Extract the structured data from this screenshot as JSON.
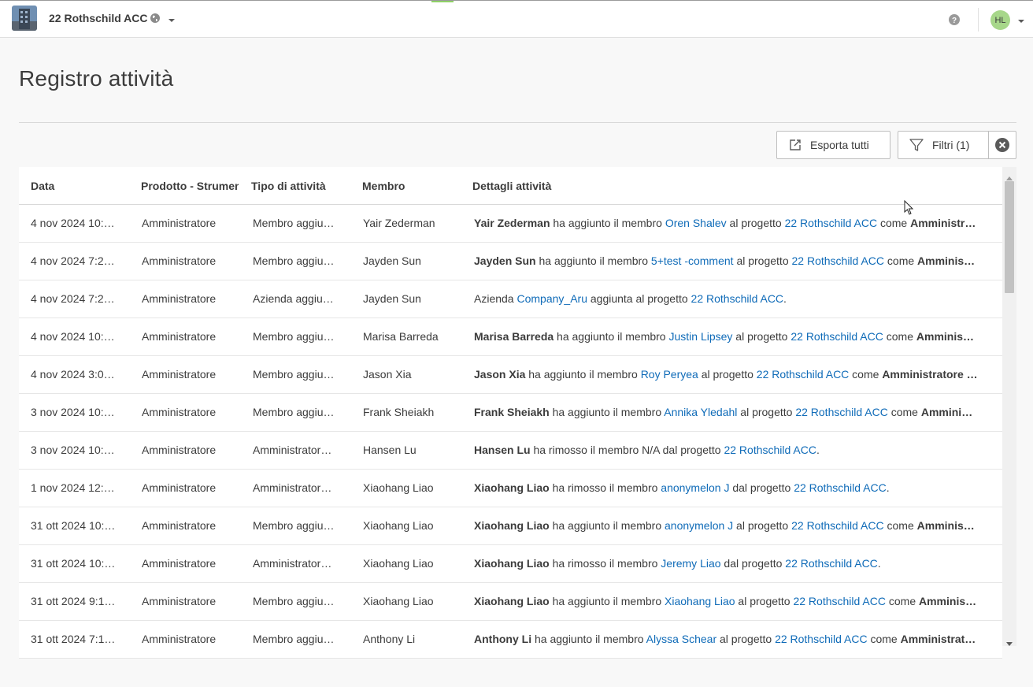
{
  "header": {
    "project_name": "22 Rothschild ACC",
    "avatar_initials": "HL",
    "icons": [
      "project-thumbnail",
      "globe-icon",
      "chevron-down-icon",
      "help-icon",
      "chevron-down-icon"
    ]
  },
  "page": {
    "title": "Registro attività"
  },
  "toolbar": {
    "export_label": "Esporta tutti",
    "filter_label": "Filtri (1)"
  },
  "table": {
    "columns": [
      "Data",
      "Prodotto - Strumento",
      "Tipo di attività",
      "Membro",
      "Dettagli attività"
    ],
    "rows": [
      {
        "date": "4 nov 2024 10:…",
        "product": "Amministratore",
        "type": "Membro aggiu…",
        "member": "Yair Zederman",
        "detail": [
          {
            "t": "b",
            "v": "Yair Zederman"
          },
          {
            "t": "s",
            "v": " ha aggiunto il membro "
          },
          {
            "t": "l",
            "v": "Oren Shalev"
          },
          {
            "t": "s",
            "v": " al progetto "
          },
          {
            "t": "l",
            "v": "22 Rothschild ACC"
          },
          {
            "t": "s",
            "v": " come "
          },
          {
            "t": "b",
            "v": "Amministr…"
          }
        ]
      },
      {
        "date": "4 nov 2024 7:2…",
        "product": "Amministratore",
        "type": "Membro aggiu…",
        "member": "Jayden Sun",
        "detail": [
          {
            "t": "b",
            "v": "Jayden Sun"
          },
          {
            "t": "s",
            "v": " ha aggiunto il membro "
          },
          {
            "t": "l",
            "v": "5+test -comment"
          },
          {
            "t": "s",
            "v": " al progetto "
          },
          {
            "t": "l",
            "v": "22 Rothschild ACC"
          },
          {
            "t": "s",
            "v": " come "
          },
          {
            "t": "b",
            "v": "Amminis…"
          }
        ]
      },
      {
        "date": "4 nov 2024 7:2…",
        "product": "Amministratore",
        "type": "Azienda aggiu…",
        "member": "Jayden Sun",
        "detail": [
          {
            "t": "s",
            "v": "Azienda "
          },
          {
            "t": "l",
            "v": "Company_Aru"
          },
          {
            "t": "s",
            "v": " aggiunta al progetto "
          },
          {
            "t": "l",
            "v": "22 Rothschild ACC"
          },
          {
            "t": "s",
            "v": "."
          }
        ]
      },
      {
        "date": "4 nov 2024 10:…",
        "product": "Amministratore",
        "type": "Membro aggiu…",
        "member": "Marisa Barreda",
        "detail": [
          {
            "t": "b",
            "v": "Marisa Barreda"
          },
          {
            "t": "s",
            "v": " ha aggiunto il membro "
          },
          {
            "t": "l",
            "v": "Justin Lipsey"
          },
          {
            "t": "s",
            "v": " al progetto "
          },
          {
            "t": "l",
            "v": "22 Rothschild ACC"
          },
          {
            "t": "s",
            "v": " come "
          },
          {
            "t": "b",
            "v": "Amminis…"
          }
        ]
      },
      {
        "date": "4 nov 2024 3:0…",
        "product": "Amministratore",
        "type": "Membro aggiu…",
        "member": "Jason Xia",
        "detail": [
          {
            "t": "b",
            "v": "Jason Xia"
          },
          {
            "t": "s",
            "v": " ha aggiunto il membro "
          },
          {
            "t": "l",
            "v": "Roy Peryea"
          },
          {
            "t": "s",
            "v": " al progetto "
          },
          {
            "t": "l",
            "v": "22 Rothschild ACC"
          },
          {
            "t": "s",
            "v": " come "
          },
          {
            "t": "b",
            "v": "Amministratore …"
          }
        ]
      },
      {
        "date": "3 nov 2024 10:…",
        "product": "Amministratore",
        "type": "Membro aggiu…",
        "member": "Frank Sheiakh",
        "detail": [
          {
            "t": "b",
            "v": "Frank Sheiakh"
          },
          {
            "t": "s",
            "v": " ha aggiunto il membro "
          },
          {
            "t": "l",
            "v": "Annika Yledahl"
          },
          {
            "t": "s",
            "v": " al progetto "
          },
          {
            "t": "l",
            "v": "22 Rothschild ACC"
          },
          {
            "t": "s",
            "v": " come "
          },
          {
            "t": "b",
            "v": "Ammini…"
          }
        ]
      },
      {
        "date": "3 nov 2024 10:…",
        "product": "Amministratore",
        "type": "Amministrator…",
        "member": "Hansen Lu",
        "detail": [
          {
            "t": "b",
            "v": "Hansen Lu"
          },
          {
            "t": "s",
            "v": " ha rimosso il membro N/A dal progetto "
          },
          {
            "t": "l",
            "v": "22 Rothschild ACC"
          },
          {
            "t": "s",
            "v": "."
          }
        ]
      },
      {
        "date": "1 nov 2024 12:…",
        "product": "Amministratore",
        "type": "Amministrator…",
        "member": "Xiaohang Liao",
        "detail": [
          {
            "t": "b",
            "v": "Xiaohang Liao"
          },
          {
            "t": "s",
            "v": " ha rimosso il membro "
          },
          {
            "t": "l",
            "v": "anonymelon J"
          },
          {
            "t": "s",
            "v": " dal progetto "
          },
          {
            "t": "l",
            "v": "22 Rothschild ACC"
          },
          {
            "t": "s",
            "v": "."
          }
        ]
      },
      {
        "date": "31 ott 2024 10:…",
        "product": "Amministratore",
        "type": "Membro aggiu…",
        "member": "Xiaohang Liao",
        "detail": [
          {
            "t": "b",
            "v": "Xiaohang Liao"
          },
          {
            "t": "s",
            "v": " ha aggiunto il membro "
          },
          {
            "t": "l",
            "v": "anonymelon J"
          },
          {
            "t": "s",
            "v": " al progetto "
          },
          {
            "t": "l",
            "v": "22 Rothschild ACC"
          },
          {
            "t": "s",
            "v": " come "
          },
          {
            "t": "b",
            "v": "Amminis…"
          }
        ]
      },
      {
        "date": "31 ott 2024 10:…",
        "product": "Amministratore",
        "type": "Amministrator…",
        "member": "Xiaohang Liao",
        "detail": [
          {
            "t": "b",
            "v": "Xiaohang Liao"
          },
          {
            "t": "s",
            "v": " ha rimosso il membro "
          },
          {
            "t": "l",
            "v": "Jeremy Liao"
          },
          {
            "t": "s",
            "v": " dal progetto "
          },
          {
            "t": "l",
            "v": "22 Rothschild ACC"
          },
          {
            "t": "s",
            "v": "."
          }
        ]
      },
      {
        "date": "31 ott 2024 9:1…",
        "product": "Amministratore",
        "type": "Membro aggiu…",
        "member": "Xiaohang Liao",
        "detail": [
          {
            "t": "b",
            "v": "Xiaohang Liao"
          },
          {
            "t": "s",
            "v": " ha aggiunto il membro "
          },
          {
            "t": "l",
            "v": "Xiaohang Liao"
          },
          {
            "t": "s",
            "v": " al progetto "
          },
          {
            "t": "l",
            "v": "22 Rothschild ACC"
          },
          {
            "t": "s",
            "v": " come "
          },
          {
            "t": "b",
            "v": "Amminis…"
          }
        ]
      },
      {
        "date": "31 ott 2024 7:1…",
        "product": "Amministratore",
        "type": "Membro aggiu…",
        "member": "Anthony Li",
        "detail": [
          {
            "t": "b",
            "v": "Anthony Li"
          },
          {
            "t": "s",
            "v": " ha aggiunto il membro "
          },
          {
            "t": "l",
            "v": "Alyssa Schear"
          },
          {
            "t": "s",
            "v": " al progetto "
          },
          {
            "t": "l",
            "v": "22 Rothschild ACC"
          },
          {
            "t": "s",
            "v": " come "
          },
          {
            "t": "b",
            "v": "Amministrat…"
          }
        ]
      }
    ]
  },
  "colors": {
    "link": "#0f6bb8",
    "avatar_bg": "#a7d78a",
    "progress_accent": "#8fd067"
  }
}
